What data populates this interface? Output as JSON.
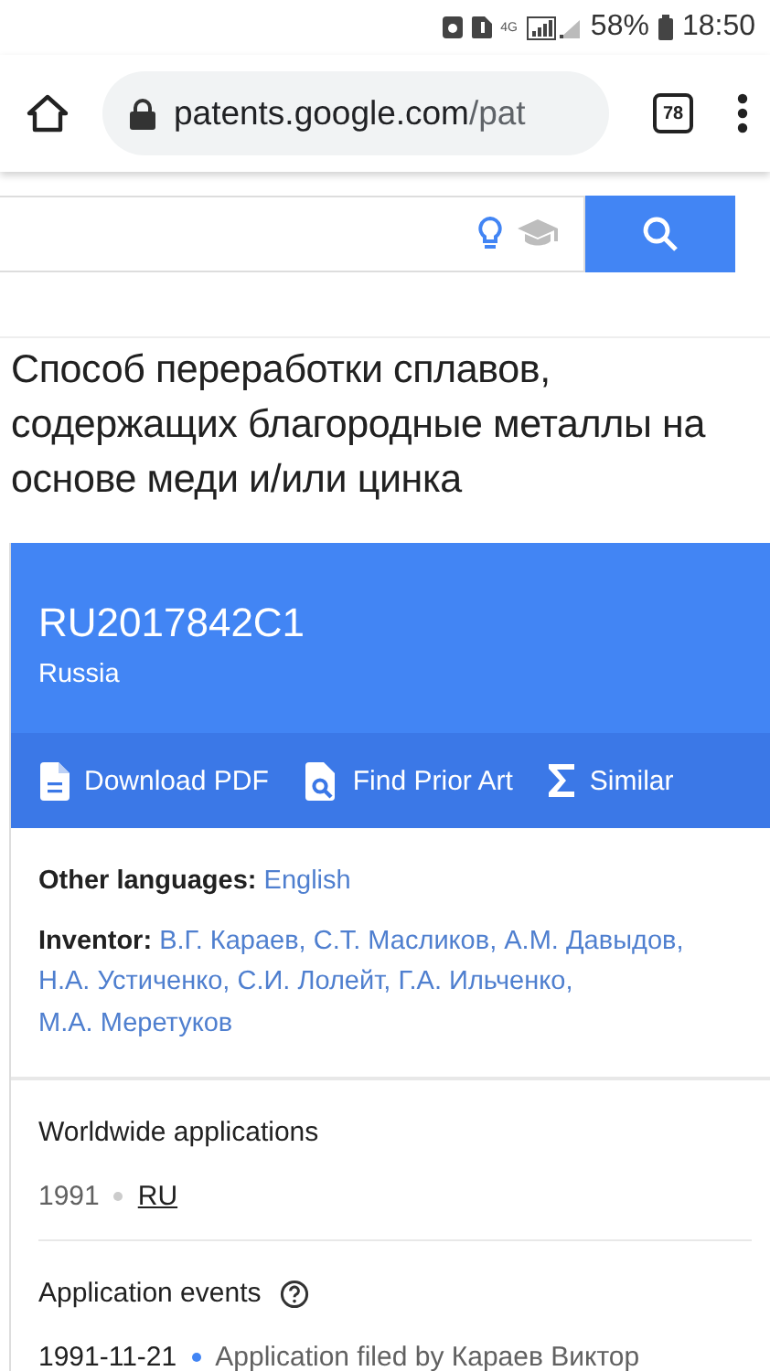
{
  "status_bar": {
    "network": "4G",
    "battery": "58%",
    "time": "18:50"
  },
  "browser": {
    "url_host": "patents.google.com",
    "url_path": "/pat",
    "tab_count": "78"
  },
  "title": "Способ переработки сплавов, содержащих благородные металлы на основе меди и/или цинка",
  "patent": {
    "number": "RU2017842C1",
    "country": "Russia",
    "actions": [
      {
        "kind": "pdf",
        "label": "Download PDF"
      },
      {
        "kind": "prior_art",
        "label": "Find Prior Art"
      },
      {
        "kind": "similar",
        "label": "Similar"
      }
    ],
    "other_languages": {
      "label": "Other languages:",
      "links": [
        "English"
      ]
    },
    "inventor": {
      "label": "Inventor:",
      "names": [
        "В.Г. Караев,",
        "С.Т. Масликов,",
        "А.М. Давыдов,",
        "Н.А. Устиченко,",
        "С.И. Лолейт,",
        "Г.А. Ильченко,",
        "М.А. Меретуков"
      ]
    }
  },
  "worldwide_applications": {
    "heading": "Worldwide applications",
    "items": [
      {
        "year": "1991",
        "country": "RU"
      }
    ]
  },
  "application_events": {
    "heading": "Application events",
    "items": [
      {
        "date": "1991-11-21",
        "text": "Application filed by Караев Виктор"
      }
    ]
  }
}
